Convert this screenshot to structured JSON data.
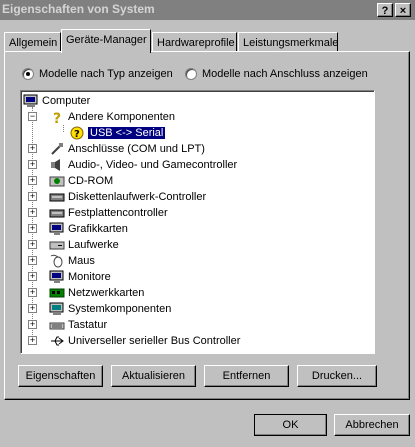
{
  "window": {
    "title": "Eigenschaften von System"
  },
  "tabs": [
    {
      "label": "Allgemein"
    },
    {
      "label": "Geräte-Manager"
    },
    {
      "label": "Hardwareprofile"
    },
    {
      "label": "Leistungsmerkmale"
    }
  ],
  "view": {
    "by_type": "Modelle nach Typ anzeigen",
    "by_connection": "Modelle nach Anschluss anzeigen",
    "selected": "by_type"
  },
  "tree": {
    "root": "Computer",
    "items": [
      {
        "label": "Andere Komponenten",
        "expanded": true,
        "icon": "question-icon"
      },
      {
        "label": "USB <-> Serial",
        "selected": true,
        "child": true,
        "icon": "question-icon"
      },
      {
        "label": "Anschlüsse (COM und LPT)",
        "icon": "port-icon"
      },
      {
        "label": "Audio-, Video- und Gamecontroller",
        "icon": "speaker-icon"
      },
      {
        "label": "CD-ROM",
        "icon": "cdrom-icon"
      },
      {
        "label": "Diskettenlaufwerk-Controller",
        "icon": "controller-icon"
      },
      {
        "label": "Festplattencontroller",
        "icon": "controller-icon"
      },
      {
        "label": "Grafikkarten",
        "icon": "monitor-icon"
      },
      {
        "label": "Laufwerke",
        "icon": "drive-icon"
      },
      {
        "label": "Maus",
        "icon": "mouse-icon"
      },
      {
        "label": "Monitore",
        "icon": "monitor-icon"
      },
      {
        "label": "Netzwerkkarten",
        "icon": "network-card-icon"
      },
      {
        "label": "Systemkomponenten",
        "icon": "computer-icon"
      },
      {
        "label": "Tastatur",
        "icon": "keyboard-icon"
      },
      {
        "label": "Universeller serieller Bus Controller",
        "icon": "usb-icon"
      }
    ]
  },
  "buttons": {
    "properties": "Eigenschaften",
    "refresh": "Aktualisieren",
    "remove": "Entfernen",
    "print": "Drucken...",
    "ok": "OK",
    "cancel": "Abbrechen"
  },
  "colors": {
    "selection": "#000080",
    "titlebar": "#808080",
    "face": "#c0c0c0"
  }
}
